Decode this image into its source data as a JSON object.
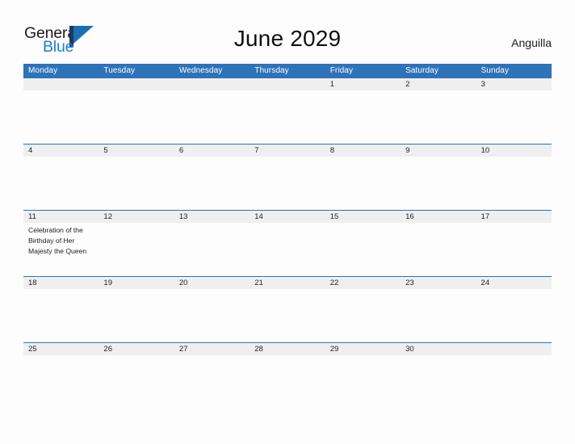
{
  "brand": {
    "name_part1": "General",
    "name_part2": "Blue",
    "flag_icon": "flag-triangle-icon",
    "accent_color": "#1d7fd4"
  },
  "header": {
    "title": "June 2029",
    "location": "Anguilla"
  },
  "colors": {
    "header_blue": "#2e72b8",
    "row_band_gray": "#efefef",
    "page_background": "#fdfdfd",
    "text_dark": "#1b1b1b"
  },
  "calendar": {
    "month": "June",
    "year": "2029",
    "weekday_headers": [
      "Monday",
      "Tuesday",
      "Wednesday",
      "Thursday",
      "Friday",
      "Saturday",
      "Sunday"
    ],
    "weeks": [
      {
        "days": [
          {
            "num": "",
            "event": ""
          },
          {
            "num": "",
            "event": ""
          },
          {
            "num": "",
            "event": ""
          },
          {
            "num": "",
            "event": ""
          },
          {
            "num": "1",
            "event": ""
          },
          {
            "num": "2",
            "event": ""
          },
          {
            "num": "3",
            "event": ""
          }
        ]
      },
      {
        "days": [
          {
            "num": "4",
            "event": ""
          },
          {
            "num": "5",
            "event": ""
          },
          {
            "num": "6",
            "event": ""
          },
          {
            "num": "7",
            "event": ""
          },
          {
            "num": "8",
            "event": ""
          },
          {
            "num": "9",
            "event": ""
          },
          {
            "num": "10",
            "event": ""
          }
        ]
      },
      {
        "days": [
          {
            "num": "11",
            "event": "Celebration of the Birthday of Her Majesty the Queen"
          },
          {
            "num": "12",
            "event": ""
          },
          {
            "num": "13",
            "event": ""
          },
          {
            "num": "14",
            "event": ""
          },
          {
            "num": "15",
            "event": ""
          },
          {
            "num": "16",
            "event": ""
          },
          {
            "num": "17",
            "event": ""
          }
        ]
      },
      {
        "days": [
          {
            "num": "18",
            "event": ""
          },
          {
            "num": "19",
            "event": ""
          },
          {
            "num": "20",
            "event": ""
          },
          {
            "num": "21",
            "event": ""
          },
          {
            "num": "22",
            "event": ""
          },
          {
            "num": "23",
            "event": ""
          },
          {
            "num": "24",
            "event": ""
          }
        ]
      },
      {
        "days": [
          {
            "num": "25",
            "event": ""
          },
          {
            "num": "26",
            "event": ""
          },
          {
            "num": "27",
            "event": ""
          },
          {
            "num": "28",
            "event": ""
          },
          {
            "num": "29",
            "event": ""
          },
          {
            "num": "30",
            "event": ""
          },
          {
            "num": "",
            "event": ""
          }
        ]
      }
    ]
  }
}
